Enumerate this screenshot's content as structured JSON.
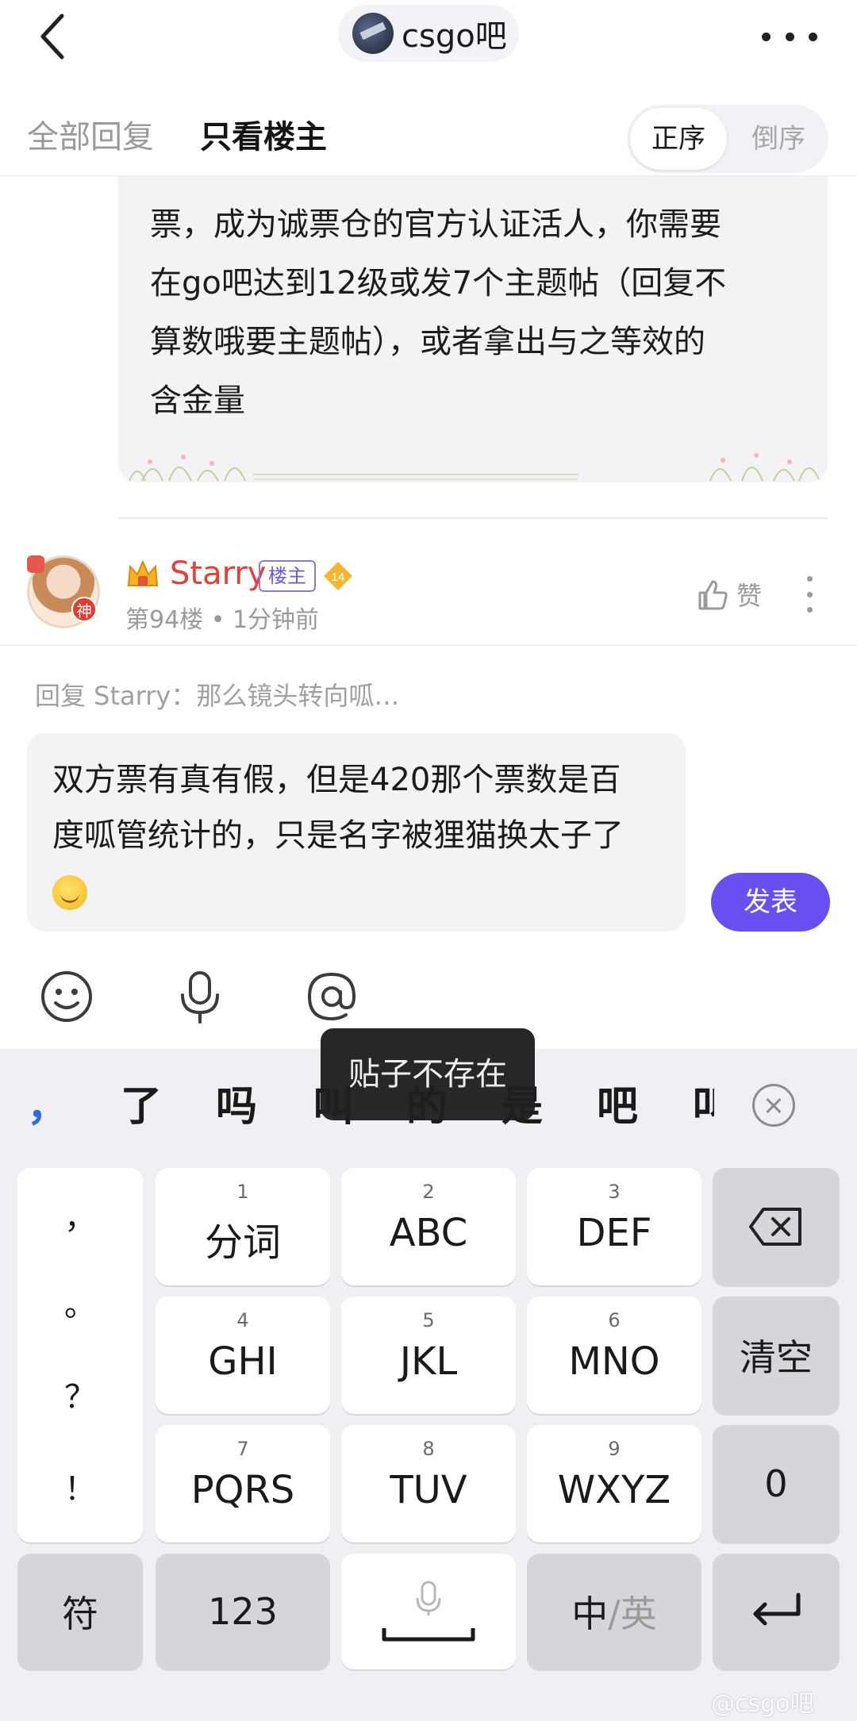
{
  "header": {
    "forum_name": "csgo吧"
  },
  "filter": {
    "tab_all": "全部回复",
    "tab_owner": "只看楼主",
    "order_asc": "正序",
    "order_desc": "倒序"
  },
  "quoted_post": {
    "lines": [
      "票，成为诚票仓的官方认证活人，你需要",
      "在go吧达到12级或发7个主题帖（回复不",
      "算数哦要主题帖），或者拿出与之等效的",
      "含金量"
    ]
  },
  "post": {
    "username": "Starry",
    "owner_badge": "楼主",
    "level": "14",
    "avatar_badge": "神",
    "floor_time": "第94楼 • 1分钟前",
    "like_label": "赞"
  },
  "composer": {
    "reply_hint": "回复 Starry：那么镜头转向呱…",
    "text_line1": "双方票有真有假，但是420那个票数是百",
    "text_line2": "度呱管统计的，只是名字被狸猫换太子了",
    "send_label": "发表"
  },
  "toast": {
    "message": "贴子不存在"
  },
  "keyboard": {
    "candidates": [
      "，",
      "了",
      "吗",
      "叫",
      "的",
      "是",
      "吧",
      "叫"
    ],
    "punctuation": [
      "，",
      "。",
      "？",
      "！"
    ],
    "keys_row1": [
      {
        "num": "1",
        "label": "分词"
      },
      {
        "num": "2",
        "label": "ABC"
      },
      {
        "num": "3",
        "label": "DEF"
      }
    ],
    "keys_row2": [
      {
        "num": "4",
        "label": "GHI"
      },
      {
        "num": "5",
        "label": "JKL"
      },
      {
        "num": "6",
        "label": "MNO"
      }
    ],
    "keys_row3": [
      {
        "num": "7",
        "label": "PQRS"
      },
      {
        "num": "8",
        "label": "TUV"
      },
      {
        "num": "9",
        "label": "WXYZ"
      }
    ],
    "clear_label": "清空",
    "zero_label": "0",
    "symbol_label": "符",
    "num_label": "123",
    "lang_cn": "中",
    "lang_sep_en": "/英"
  },
  "watermark": "@csgo吧",
  "colors": {
    "accent": "#6a4ff0",
    "username": "#e0423a",
    "owner_badge": "#6f58d6"
  }
}
